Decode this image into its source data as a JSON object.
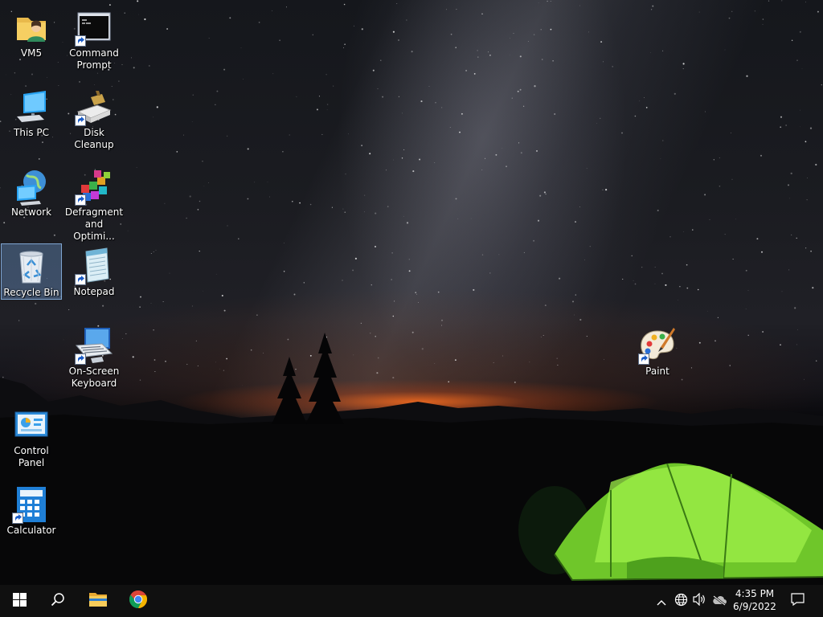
{
  "desktop": {
    "icons": [
      {
        "id": "vm5",
        "label": "VM5",
        "icon": "user-folder-icon"
      },
      {
        "id": "command-prompt",
        "label": "Command\nPrompt",
        "icon": "command-prompt-icon"
      },
      {
        "id": "this-pc",
        "label": "This PC",
        "icon": "computer-icon"
      },
      {
        "id": "disk-cleanup",
        "label": "Disk Cleanup",
        "icon": "disk-cleanup-icon"
      },
      {
        "id": "network",
        "label": "Network",
        "icon": "network-icon"
      },
      {
        "id": "defragment",
        "label": "Defragment\nand Optimi...",
        "icon": "defragment-icon"
      },
      {
        "id": "recycle-bin",
        "label": "Recycle Bin",
        "icon": "recycle-bin-icon",
        "selected": true
      },
      {
        "id": "notepad",
        "label": "Notepad",
        "icon": "notepad-icon"
      },
      {
        "id": "on-screen-keyboard",
        "label": "On-Screen\nKeyboard",
        "icon": "keyboard-icon"
      },
      {
        "id": "paint",
        "label": "Paint",
        "icon": "paint-palette-icon"
      },
      {
        "id": "control-panel",
        "label": "Control Panel",
        "icon": "control-panel-icon"
      },
      {
        "id": "calculator",
        "label": "Calculator",
        "icon": "calculator-icon"
      }
    ]
  },
  "taskbar": {
    "start": {
      "icon": "windows-logo-icon"
    },
    "search": {
      "icon": "search-icon"
    },
    "pinned": [
      {
        "name": "file-explorer",
        "icon": "folder-icon"
      },
      {
        "name": "chrome",
        "icon": "chrome-icon"
      }
    ],
    "tray": {
      "icons": [
        "chevron-up-icon",
        "globe-icon",
        "volume-icon",
        "cloud-offline-icon"
      ],
      "time": "4:35 PM",
      "date": "6/9/2022",
      "notification_icon": "action-center-icon"
    }
  },
  "colors": {
    "taskbar_bg": "#101010",
    "selection": "#78AAE6",
    "tent_green": "#8EE63A",
    "horizon_glow": "#FF6E1E"
  }
}
